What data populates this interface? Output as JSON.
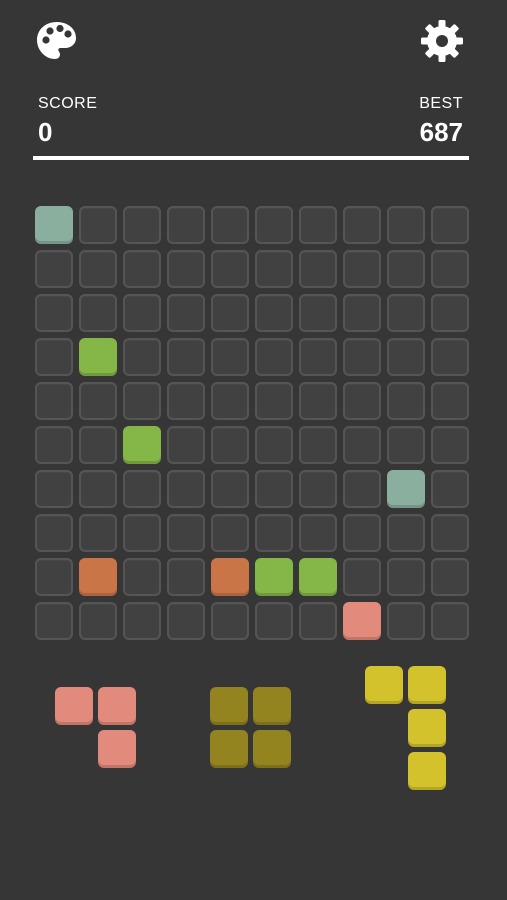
{
  "header": {
    "palette_icon": "palette-icon",
    "settings_icon": "gear-icon",
    "score_label": "SCORE",
    "score_value": "0",
    "best_label": "BEST",
    "best_value": "687"
  },
  "colors": {
    "background": "#363636",
    "empty_cell": "#414141",
    "empty_border": "#555555",
    "teal": "#8aaf9f",
    "green": "#84b648",
    "orange": "#c97548",
    "pink": "#e28a7c",
    "olive": "#948420",
    "yellow": "#d4c22c"
  },
  "board": {
    "rows": 10,
    "cols": 10,
    "filled": [
      {
        "row": 0,
        "col": 0,
        "color": "teal"
      },
      {
        "row": 3,
        "col": 1,
        "color": "green"
      },
      {
        "row": 5,
        "col": 2,
        "color": "green"
      },
      {
        "row": 6,
        "col": 8,
        "color": "teal"
      },
      {
        "row": 8,
        "col": 1,
        "color": "orange"
      },
      {
        "row": 8,
        "col": 4,
        "color": "orange"
      },
      {
        "row": 8,
        "col": 5,
        "color": "green"
      },
      {
        "row": 8,
        "col": 6,
        "color": "green"
      },
      {
        "row": 9,
        "col": 7,
        "color": "pink"
      }
    ]
  },
  "pieces": [
    {
      "name": "piece-pink-corner",
      "color": "pink",
      "cells": [
        [
          0,
          0
        ],
        [
          0,
          1
        ],
        [
          1,
          1
        ]
      ]
    },
    {
      "name": "piece-olive-square",
      "color": "olive",
      "cells": [
        [
          0,
          0
        ],
        [
          0,
          1
        ],
        [
          1,
          0
        ],
        [
          1,
          1
        ]
      ]
    },
    {
      "name": "piece-yellow-l",
      "color": "yellow",
      "cells": [
        [
          0,
          0
        ],
        [
          0,
          1
        ],
        [
          1,
          1
        ],
        [
          2,
          1
        ]
      ]
    }
  ]
}
